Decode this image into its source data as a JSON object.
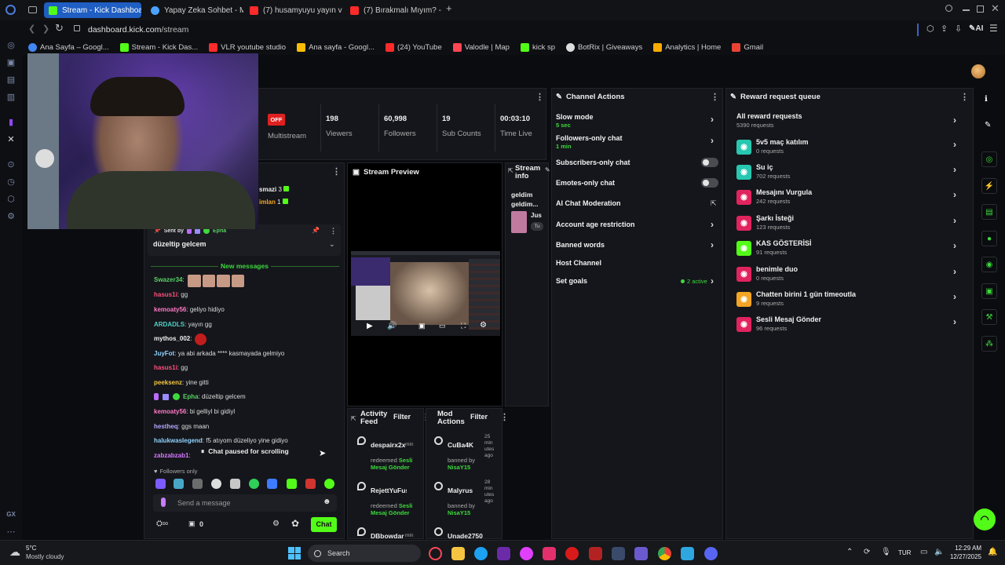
{
  "browser": {
    "tabs": [
      {
        "label": "Stream - Kick Dashboard",
        "active": true,
        "color": "#53fc18"
      },
      {
        "label": "Yapay Zeka Sohbet - Miss",
        "color": "#4aa3ff"
      },
      {
        "label": "(7) husamyuyu yayın vakti",
        "color": "#ff2a2a"
      },
      {
        "label": "(7) Bırakmalı Mıyım? - You",
        "color": "#ff2a2a"
      }
    ],
    "url_host": "dashboard.kick.com",
    "url_path": "/stream",
    "toolbar_ai": "AI",
    "bookmarks": [
      {
        "label": "Ana Sayfa – Googl...",
        "color": "#4285f4"
      },
      {
        "label": "Stream - Kick Das...",
        "color": "#53fc18"
      },
      {
        "label": "VLR youtube studio",
        "color": "#ff2a2a"
      },
      {
        "label": "Ana sayfa - Googl...",
        "color": "#fbbc04"
      },
      {
        "label": "(24) YouTube",
        "color": "#ff2a2a"
      },
      {
        "label": "Valodle | Map",
        "color": "#ff4655"
      },
      {
        "label": "kick sp",
        "color": "#53fc18"
      },
      {
        "label": "BotRix | Giveaways",
        "color": "#dddddd"
      },
      {
        "label": "Analytics | Home",
        "color": "#f9ab00"
      },
      {
        "label": "Gmail",
        "color": "#ea4335"
      }
    ]
  },
  "stats": {
    "status": "OFF",
    "multistream": "Multistream",
    "viewers": {
      "value": "198",
      "label": "Viewers"
    },
    "followers": {
      "value": "60,998",
      "label": "Followers"
    },
    "subs": {
      "value": "19",
      "label": "Sub Counts"
    },
    "time": {
      "value": "00:03:10",
      "label": "Time Live"
    }
  },
  "chat": {
    "top_users": [
      {
        "name": "smazi",
        "count": "3"
      },
      {
        "name": "imlan",
        "count": "1"
      }
    ],
    "pinned": {
      "sent_by": "Sent by",
      "user": "Epha",
      "message": "düzeltip gelcem"
    },
    "new_messages": "New messages",
    "lines": [
      {
        "user": "Swazer34",
        "text": "",
        "color": "#56d364"
      },
      {
        "user": "hasus1i",
        "text": "gg",
        "color": "#ff4f7a"
      },
      {
        "user": "kemoaty56",
        "text": "geliyo hidiyo",
        "color": "#ff79c6"
      },
      {
        "user": "ARDADLS",
        "text": "yayın gg",
        "color": "#4fd1c5"
      },
      {
        "user": "mythos_002",
        "text": "",
        "color": "#f0f0f0"
      },
      {
        "user": "JuyFot",
        "text": "ya abi arkada **** kasmayada gelmiyo",
        "color": "#8fd3ff"
      },
      {
        "user": "hasus1i",
        "text": "gg",
        "color": "#ff4f7a"
      },
      {
        "user": "peeksenz",
        "text": "yine gitti",
        "color": "#f5c542"
      },
      {
        "user": "Epha",
        "text": "düzeltip gelcem",
        "color": "#56d364"
      },
      {
        "user": "kemoaty56",
        "text": "bi gelliyl bi gidiyl",
        "color": "#ff79c6"
      },
      {
        "user": "hestheq",
        "text": "ggs maan",
        "color": "#b4a7ff"
      },
      {
        "user": "halukwaslegend",
        "text": "f5 atıyom düzeliyo yine gidiyo",
        "color": "#8fd3ff"
      },
      {
        "user": "zabzabzab1",
        "text": "",
        "color": "#d67aff"
      }
    ],
    "paused": "Chat paused for scrolling",
    "followers_only": "Followers only",
    "input_placeholder": "Send a message",
    "count": "0",
    "send": "Chat"
  },
  "preview": {
    "title": "Stream Preview"
  },
  "stream_info": {
    "title": "Stream info",
    "text": "geldim geldim...",
    "card_text": "Jus",
    "card_tag": "Tu"
  },
  "activity": {
    "title": "Activity Feed",
    "filter": "Filter",
    "items": [
      {
        "user": "despairx2x",
        "time": "min",
        "action": "redeemed",
        "reward": "Sesli Mesaj Gönder"
      },
      {
        "user": "RejettYuFus12",
        "time": "",
        "action": "redeemed",
        "reward": "Sesli Mesaj Gönder"
      },
      {
        "user": "DBbowdar",
        "time": "min",
        "action": "",
        "reward": ""
      }
    ]
  },
  "mod_actions": {
    "title": "Mod Actions",
    "filter": "Filter",
    "items": [
      {
        "user": "CuBa4K",
        "time": "25 minutes ago",
        "action": "banned by",
        "by": "NisaY15"
      },
      {
        "user": "Malyrus",
        "time": "28 minutes ago",
        "action": "banned by",
        "by": "NisaY15"
      },
      {
        "user": "Unade2750",
        "time": "",
        "action": "",
        "by": ""
      }
    ]
  },
  "channel_actions": {
    "title": "Channel Actions",
    "items": [
      {
        "label": "Slow mode",
        "sub": "5 sec",
        "control": "chevron"
      },
      {
        "label": "Followers-only chat",
        "sub": "1 min",
        "control": "chevron"
      },
      {
        "label": "Subscribers-only chat",
        "sub": "",
        "control": "toggle"
      },
      {
        "label": "Emotes-only chat",
        "sub": "",
        "control": "toggle"
      },
      {
        "label": "AI Chat Moderation",
        "sub": "",
        "control": "external"
      },
      {
        "label": "Account age restriction",
        "sub": "",
        "control": "chevron"
      },
      {
        "label": "Banned words",
        "sub": "",
        "control": "chevron"
      },
      {
        "label": "Host Channel",
        "sub": "",
        "control": "none"
      },
      {
        "label": "Set goals",
        "sub": "",
        "control": "chevron",
        "badge": "2 active"
      }
    ]
  },
  "rewards": {
    "title": "Reward request queue",
    "all_label": "All reward requests",
    "all_count": "5390 requests",
    "items": [
      {
        "name": "5v5 maç katılım",
        "count": "0 requests",
        "color": "#28c7b0"
      },
      {
        "name": "Su iç",
        "count": "702 requests",
        "color": "#28c7b0"
      },
      {
        "name": "Mesajını Vurgula",
        "count": "242 requests",
        "color": "#e0245e"
      },
      {
        "name": "Şarkı İsteği",
        "count": "123 requests",
        "color": "#e0245e"
      },
      {
        "name": "KAS GÖSTERİSİ",
        "count": "91 requests",
        "color": "#53fc18"
      },
      {
        "name": "benimle duo",
        "count": "0 requests",
        "color": "#e0245e"
      },
      {
        "name": "Chatten birini 1 gün timeoutla",
        "count": "9 requests",
        "color": "#f5a524"
      },
      {
        "name": "Sesli Mesaj Gönder",
        "count": "96 requests",
        "color": "#e0245e"
      }
    ]
  },
  "taskbar": {
    "weather_temp": "5°C",
    "weather_desc": "Mostly cloudy",
    "search": "Search",
    "lang": "TUR",
    "time": "12:29 AM",
    "date": "12/27/2025"
  }
}
